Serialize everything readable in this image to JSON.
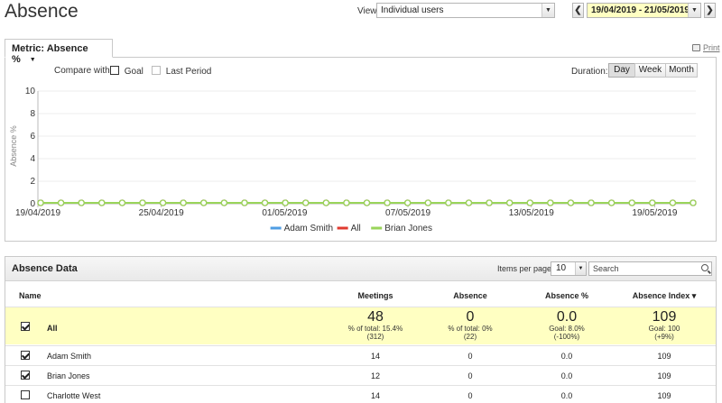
{
  "page": {
    "title": "Absence"
  },
  "view": {
    "label": "View:",
    "selected": "Individual users"
  },
  "date_nav": {
    "prev": "❮",
    "next": "❯",
    "range": "19/04/2019 - 21/05/2019"
  },
  "chart_panel": {
    "metric_tab": "Metric: Absence %",
    "print": "Print",
    "compare_label": "Compare with:",
    "goal_label": "Goal",
    "last_period_label": "Last Period",
    "duration_label": "Duration:",
    "durations": [
      "Day",
      "Week",
      "Month"
    ],
    "active_duration": "Day"
  },
  "chart_data": {
    "type": "line",
    "ylabel": "Absence %",
    "ylim": [
      0,
      10
    ],
    "yticks": [
      0,
      2,
      4,
      6,
      8,
      10
    ],
    "x_tick_labels": [
      "19/04/2019",
      "25/04/2019",
      "01/05/2019",
      "07/05/2019",
      "13/05/2019",
      "19/05/2019"
    ],
    "x_dates_start": "19/04/2019",
    "x_dates_end": "21/05/2019",
    "series": [
      {
        "name": "Adam Smith",
        "color": "#4f9de3",
        "value_all_days": 0
      },
      {
        "name": "All",
        "color": "#e03a2f",
        "value_all_days": 0
      },
      {
        "name": "Brian Jones",
        "color": "#99d45a",
        "value_all_days": 0
      }
    ],
    "legend_position": "bottom-center"
  },
  "data_panel": {
    "title": "Absence Data",
    "items_per_page_label": "Items per page",
    "items_per_page": "10",
    "search_placeholder": "Search",
    "columns": [
      "Name",
      "Meetings",
      "Absence",
      "Absence %",
      "Absence Index ▾"
    ],
    "all_row": {
      "name": "All",
      "meetings": {
        "value": "48",
        "sub1": "% of total: 15.4%",
        "sub2": "(312)"
      },
      "absence": {
        "value": "0",
        "sub1": "% of total: 0%",
        "sub2": "(22)"
      },
      "absence_pct": {
        "value": "0.0",
        "sub1": "Goal: 8.0%",
        "sub2": "(-100%)"
      },
      "absence_index": {
        "value": "109",
        "sub1": "Goal: 100",
        "sub2": "(+9%)"
      }
    },
    "rows": [
      {
        "name": "Adam Smith",
        "checked": true,
        "meetings": "14",
        "absence": "0",
        "absence_pct": "0.0",
        "absence_index": "109"
      },
      {
        "name": "Brian Jones",
        "checked": true,
        "meetings": "12",
        "absence": "0",
        "absence_pct": "0.0",
        "absence_index": "109"
      },
      {
        "name": "Charlotte West",
        "checked": false,
        "meetings": "14",
        "absence": "0",
        "absence_pct": "0.0",
        "absence_index": "109"
      }
    ]
  }
}
